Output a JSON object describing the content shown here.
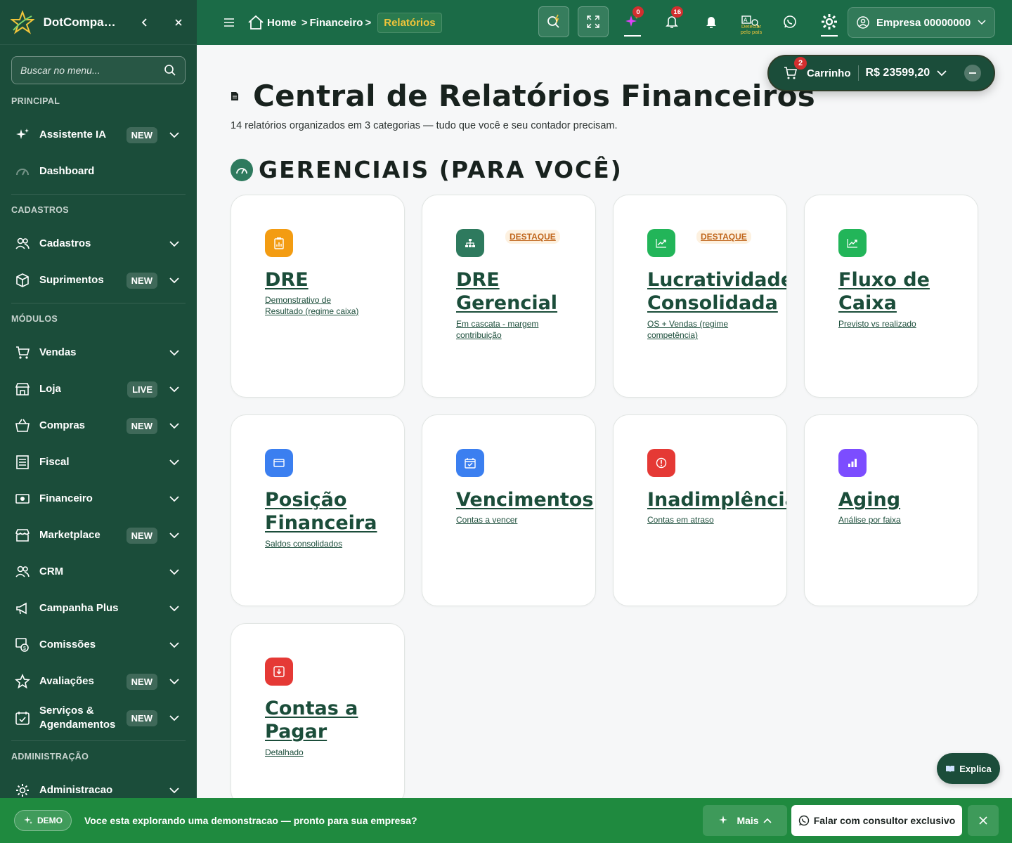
{
  "app": {
    "brand": "DotCompanion",
    "colors": {
      "sidebar": "#1b4d3a",
      "topbar": "#1b6b47",
      "accent_gold": "#f0c43a",
      "demo_bar": "#1f8a3f",
      "link_green": "#1b4d3a"
    }
  },
  "sidebar": {
    "search_placeholder": "Buscar no menu...",
    "sections": {
      "principal": "PRINCIPAL",
      "cadastros": "CADASTROS",
      "modulos": "MÓDULOS",
      "administracao": "ADMINISTRAÇÃO"
    },
    "items": [
      {
        "label": "Assistente IA",
        "badge": "NEW",
        "icon": "sparkles-icon"
      },
      {
        "label": "Dashboard",
        "badge": "",
        "icon": "gauge-icon"
      },
      {
        "label": "Cadastros",
        "badge": "",
        "icon": "users-icon"
      },
      {
        "label": "Suprimentos",
        "badge": "NEW",
        "icon": "box-icon"
      },
      {
        "label": "Vendas",
        "badge": "",
        "icon": "cart-icon"
      },
      {
        "label": "Loja",
        "badge": "LIVE",
        "icon": "store-icon"
      },
      {
        "label": "Compras",
        "badge": "NEW",
        "icon": "basket-icon"
      },
      {
        "label": "Fiscal",
        "badge": "",
        "icon": "receipt-icon"
      },
      {
        "label": "Financeiro",
        "badge": "",
        "icon": "money-icon"
      },
      {
        "label": "Marketplace",
        "badge": "NEW",
        "icon": "shop-icon"
      },
      {
        "label": "CRM",
        "badge": "",
        "icon": "users-icon"
      },
      {
        "label": "Campanha Plus",
        "badge": "",
        "icon": "megaphone-icon"
      },
      {
        "label": "Comissões",
        "badge": "",
        "icon": "commission-icon"
      },
      {
        "label": "Avaliações",
        "badge": "NEW",
        "icon": "star-icon"
      },
      {
        "label": "Serviços & Agendamentos",
        "badge": "NEW",
        "icon": "calendar-check-icon"
      },
      {
        "label": "Administracao",
        "badge": "",
        "icon": "gear-icon"
      }
    ]
  },
  "topbar": {
    "breadcrumb": {
      "home": "Home",
      "parent": "Financeiro",
      "current": "Relatórios"
    },
    "notif_ai_count": "0",
    "notif_bell_count": "16",
    "detect_label": "Detectar pelo país",
    "company": "Empresa 00000000"
  },
  "cart": {
    "count": "2",
    "label": "Carrinho",
    "total": "R$ 23599,20"
  },
  "page": {
    "title": "Central de Relatórios Financeiros",
    "subtitle": "14 relatórios organizados em 3 categorias — tudo que você e seu contador precisam.",
    "section_title": "GERENCIAIS (PARA VOCÊ)"
  },
  "reports": [
    {
      "title": "DRE",
      "desc": "Demonstrativo de Resultado (regime caixa)",
      "tag": "",
      "icon": "clipboard-chart-icon",
      "color": "#f39c12"
    },
    {
      "title": "DRE Gerencial",
      "desc": "Em cascata - margem contribuição",
      "tag": "DESTAQUE",
      "icon": "hierarchy-icon",
      "color": "#2e7a5e"
    },
    {
      "title": "Lucratividade Consolidada",
      "desc": "OS + Vendas (regime competência)",
      "tag": "DESTAQUE",
      "icon": "trend-up-icon",
      "color": "#22b559"
    },
    {
      "title": "Fluxo de Caixa",
      "desc": "Previsto vs realizado",
      "tag": "",
      "icon": "trend-up-icon",
      "color": "#22b559"
    },
    {
      "title": "Posição Financeira",
      "desc": "Saldos consolidados",
      "tag": "",
      "icon": "wallet-icon",
      "color": "#3b7ff0"
    },
    {
      "title": "Vencimentos",
      "desc": "Contas a vencer",
      "tag": "",
      "icon": "calendar-icon",
      "color": "#3b7ff0"
    },
    {
      "title": "Inadimplência",
      "desc": "Contas em atraso",
      "tag": "",
      "icon": "alert-circle-icon",
      "color": "#e53935"
    },
    {
      "title": "Aging",
      "desc": "Análise por faixa",
      "tag": "",
      "icon": "bar-chart-icon",
      "color": "#7c4dff"
    },
    {
      "title": "Contas a Pagar",
      "desc": "Detalhado",
      "tag": "",
      "icon": "download-icon",
      "color": "#e53935"
    }
  ],
  "explica": {
    "label": "Explica"
  },
  "demo": {
    "pill": "DEMO",
    "message": "Voce esta explorando uma demonstracao — pronto para sua empresa?",
    "more": "Mais",
    "cta": "Falar com consultor exclusivo"
  }
}
